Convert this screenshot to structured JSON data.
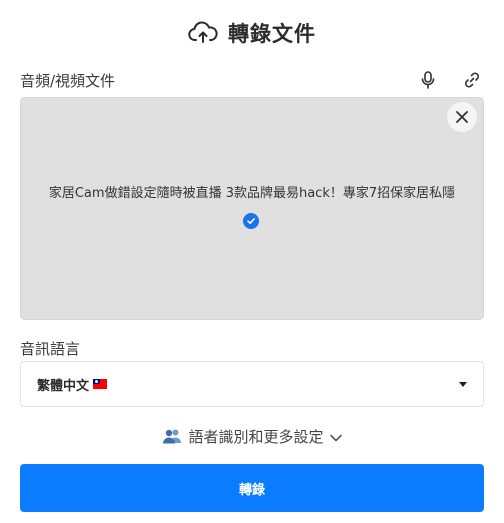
{
  "header": {
    "title": "轉錄文件",
    "icon": "cloud-upload-icon"
  },
  "file": {
    "label": "音頻/視頻文件",
    "mic_icon": "microphone-icon",
    "link_icon": "link-icon",
    "name": "家居Cam做錯設定隨時被直播 3款品牌最易hack！專家7招保家居私隱",
    "status_icon": "check-circle-icon",
    "close_icon": "close-icon"
  },
  "language": {
    "label": "音訊語言",
    "selected": "繁體中文",
    "flag": "taiwan-flag-icon"
  },
  "more_settings": {
    "label": "語者識別和更多設定",
    "icon": "people-icon"
  },
  "submit": {
    "label": "轉錄"
  },
  "colors": {
    "accent": "#0b7bff",
    "dropzone": "#e0e0e0",
    "check": "#1a73e8"
  }
}
